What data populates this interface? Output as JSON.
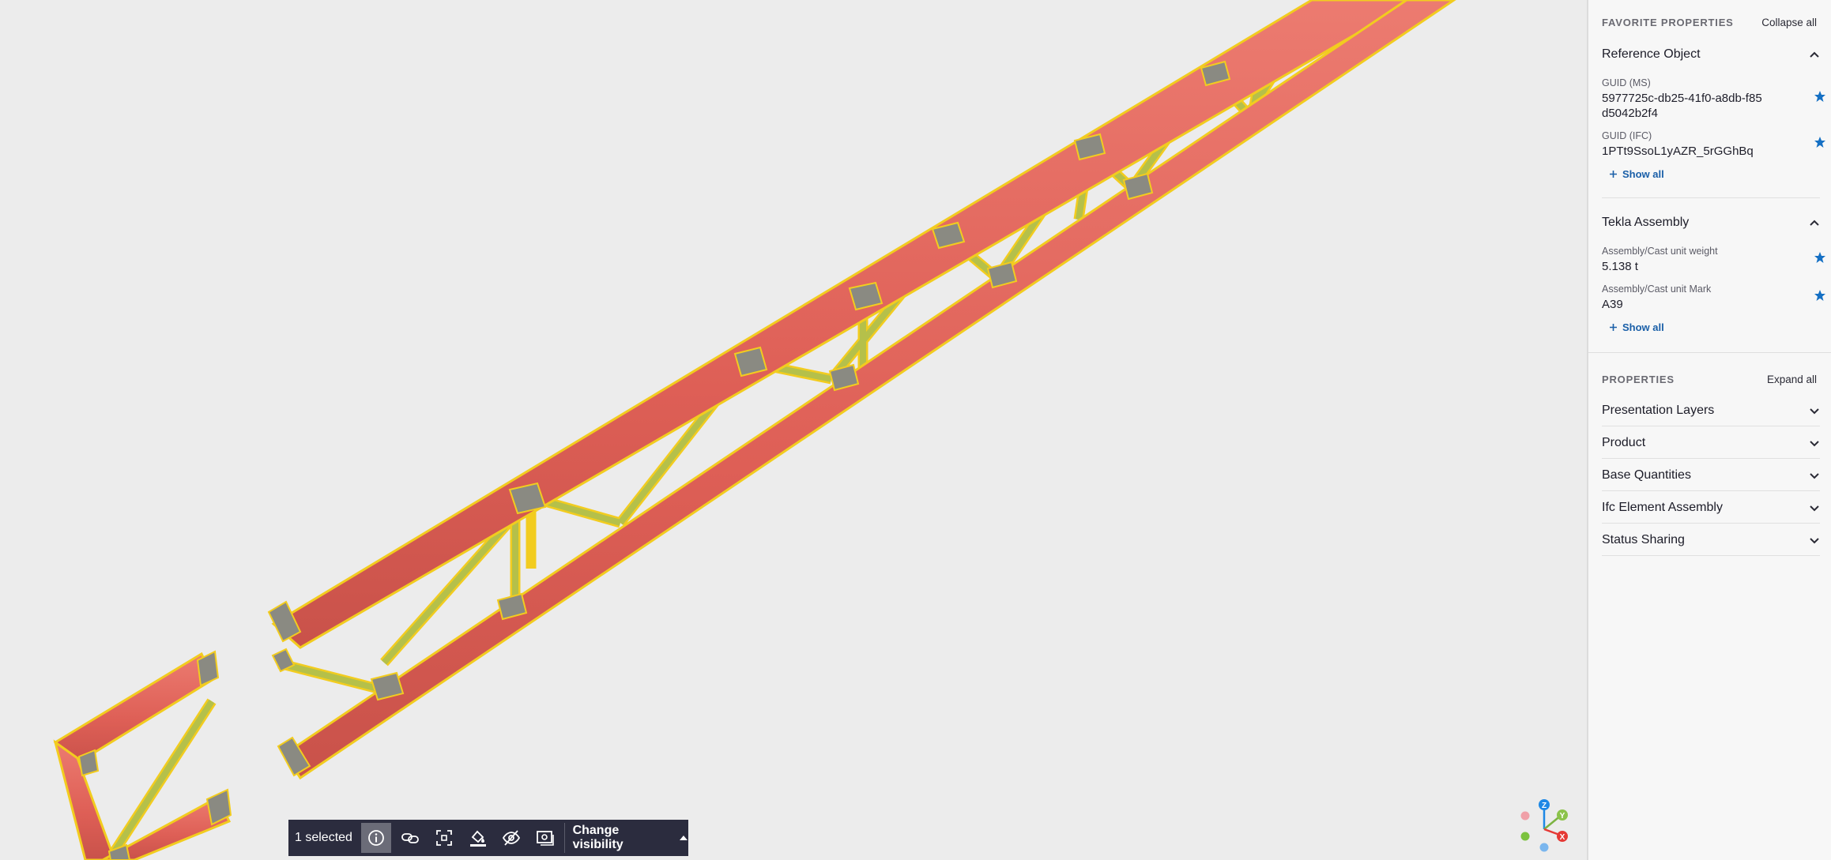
{
  "colors": {
    "chord": "#e0655c",
    "web": "#b5c04a",
    "highlight": "#f2cc1f",
    "panel_bg": "#f7f7f7",
    "link": "#1a5fa8",
    "star": "#1570c4",
    "toolbar_bg": "#2b2c3e"
  },
  "panel": {
    "favorites": {
      "title": "FAVORITE PROPERTIES",
      "toggle_label": "Collapse all",
      "groups": [
        {
          "title": "Reference Object",
          "icon": "chevron-up-icon",
          "properties": [
            {
              "label": "GUID (MS)",
              "value": "5977725c-db25-41f0-a8db-f85d5042b2f4",
              "starred": true
            },
            {
              "label": "GUID (IFC)",
              "value": "1PTt9SsoL1yAZR_5rGGhBq",
              "starred": true
            }
          ],
          "show_all": "Show all"
        },
        {
          "title": "Tekla Assembly",
          "icon": "chevron-up-icon",
          "properties": [
            {
              "label": "Assembly/Cast unit weight",
              "value": "5.138 t",
              "starred": true
            },
            {
              "label": "Assembly/Cast unit Mark",
              "value": "A39",
              "starred": true
            }
          ],
          "show_all": "Show all"
        }
      ]
    },
    "properties": {
      "title": "PROPERTIES",
      "toggle_label": "Expand all",
      "groups": [
        {
          "title": "Presentation Layers",
          "icon": "chevron-down-icon"
        },
        {
          "title": "Product",
          "icon": "chevron-down-icon"
        },
        {
          "title": "Base Quantities",
          "icon": "chevron-down-icon"
        },
        {
          "title": "Ifc Element Assembly",
          "icon": "chevron-down-icon"
        },
        {
          "title": "Status Sharing",
          "icon": "chevron-down-icon"
        }
      ]
    }
  },
  "toolbar": {
    "selection_label": "1 selected",
    "buttons": [
      {
        "icon": "info-icon",
        "active": true
      },
      {
        "icon": "link-icon",
        "active": false
      },
      {
        "icon": "fit-to-view-icon",
        "active": false
      },
      {
        "icon": "paint-bucket-icon",
        "active": false
      },
      {
        "icon": "hide-icon",
        "active": false
      },
      {
        "icon": "isolate-icon",
        "active": false
      }
    ],
    "visibility_label": "Change visibility",
    "visibility_icon": "caret-up-icon"
  },
  "axes": {
    "z": "Z",
    "y": "Y",
    "x": "X"
  }
}
